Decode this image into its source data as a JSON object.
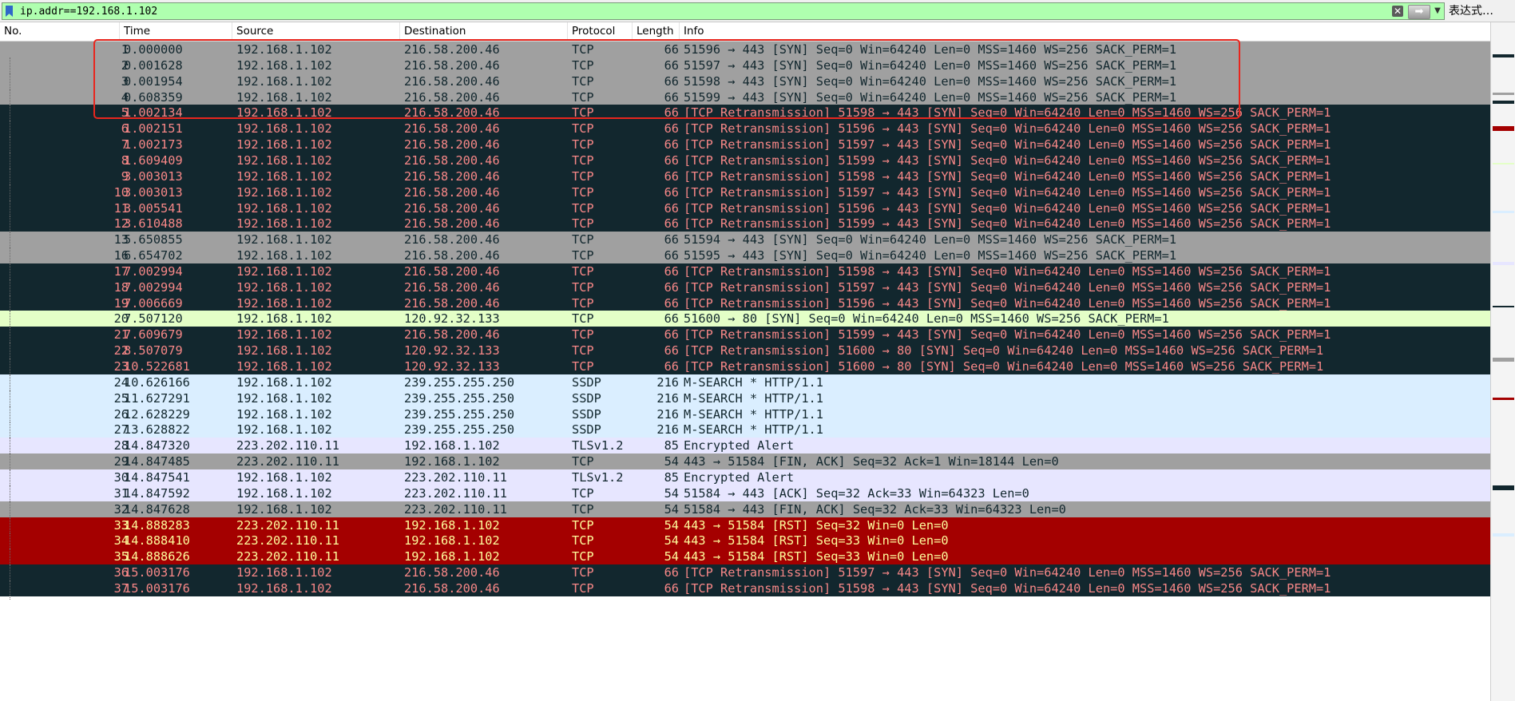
{
  "filter": {
    "value": "ip.addr==192.168.1.102",
    "clear_icon": "clear-x-icon",
    "apply_icon": "apply-arrow-icon",
    "history_icon": "chevron-down-icon",
    "expression_label": "表达式…"
  },
  "columns": [
    {
      "key": "no",
      "label": "No."
    },
    {
      "key": "time",
      "label": "Time"
    },
    {
      "key": "source",
      "label": "Source"
    },
    {
      "key": "destination",
      "label": "Destination"
    },
    {
      "key": "protocol",
      "label": "Protocol"
    },
    {
      "key": "length",
      "label": "Length"
    },
    {
      "key": "info",
      "label": "Info"
    }
  ],
  "row_colors": {
    "gray": {
      "bg": "#a0a0a0",
      "fg": "#12272e"
    },
    "retrans": {
      "bg": "#12272e",
      "fg": "#f78787"
    },
    "green": {
      "bg": "#e4ffc7",
      "fg": "#12272e"
    },
    "blue": {
      "bg": "#daeeff",
      "fg": "#12272e"
    },
    "purple": {
      "bg": "#e7e6ff",
      "fg": "#12272e"
    },
    "red": {
      "bg": "#a40000",
      "fg": "#fffc9c"
    }
  },
  "packets": [
    {
      "no": "1",
      "time": "0.000000",
      "src": "192.168.1.102",
      "dst": "216.58.200.46",
      "proto": "TCP",
      "len": "66",
      "info": "51596 → 443 [SYN] Seq=0 Win=64240 Len=0 MSS=1460 WS=256 SACK_PERM=1",
      "style": "gray"
    },
    {
      "no": "2",
      "time": "0.001628",
      "src": "192.168.1.102",
      "dst": "216.58.200.46",
      "proto": "TCP",
      "len": "66",
      "info": "51597 → 443 [SYN] Seq=0 Win=64240 Len=0 MSS=1460 WS=256 SACK_PERM=1",
      "style": "gray"
    },
    {
      "no": "3",
      "time": "0.001954",
      "src": "192.168.1.102",
      "dst": "216.58.200.46",
      "proto": "TCP",
      "len": "66",
      "info": "51598 → 443 [SYN] Seq=0 Win=64240 Len=0 MSS=1460 WS=256 SACK_PERM=1",
      "style": "gray"
    },
    {
      "no": "4",
      "time": "0.608359",
      "src": "192.168.1.102",
      "dst": "216.58.200.46",
      "proto": "TCP",
      "len": "66",
      "info": "51599 → 443 [SYN] Seq=0 Win=64240 Len=0 MSS=1460 WS=256 SACK_PERM=1",
      "style": "gray"
    },
    {
      "no": "5",
      "time": "1.002134",
      "src": "192.168.1.102",
      "dst": "216.58.200.46",
      "proto": "TCP",
      "len": "66",
      "info": "[TCP Retransmission] 51598 → 443 [SYN] Seq=0 Win=64240 Len=0 MSS=1460 WS=256 SACK_PERM=1",
      "style": "retrans"
    },
    {
      "no": "6",
      "time": "1.002151",
      "src": "192.168.1.102",
      "dst": "216.58.200.46",
      "proto": "TCP",
      "len": "66",
      "info": "[TCP Retransmission] 51596 → 443 [SYN] Seq=0 Win=64240 Len=0 MSS=1460 WS=256 SACK_PERM=1",
      "style": "retrans"
    },
    {
      "no": "7",
      "time": "1.002173",
      "src": "192.168.1.102",
      "dst": "216.58.200.46",
      "proto": "TCP",
      "len": "66",
      "info": "[TCP Retransmission] 51597 → 443 [SYN] Seq=0 Win=64240 Len=0 MSS=1460 WS=256 SACK_PERM=1",
      "style": "retrans"
    },
    {
      "no": "8",
      "time": "1.609409",
      "src": "192.168.1.102",
      "dst": "216.58.200.46",
      "proto": "TCP",
      "len": "66",
      "info": "[TCP Retransmission] 51599 → 443 [SYN] Seq=0 Win=64240 Len=0 MSS=1460 WS=256 SACK_PERM=1",
      "style": "retrans"
    },
    {
      "no": "9",
      "time": "3.003013",
      "src": "192.168.1.102",
      "dst": "216.58.200.46",
      "proto": "TCP",
      "len": "66",
      "info": "[TCP Retransmission] 51598 → 443 [SYN] Seq=0 Win=64240 Len=0 MSS=1460 WS=256 SACK_PERM=1",
      "style": "retrans"
    },
    {
      "no": "10",
      "time": "3.003013",
      "src": "192.168.1.102",
      "dst": "216.58.200.46",
      "proto": "TCP",
      "len": "66",
      "info": "[TCP Retransmission] 51597 → 443 [SYN] Seq=0 Win=64240 Len=0 MSS=1460 WS=256 SACK_PERM=1",
      "style": "retrans"
    },
    {
      "no": "11",
      "time": "3.005541",
      "src": "192.168.1.102",
      "dst": "216.58.200.46",
      "proto": "TCP",
      "len": "66",
      "info": "[TCP Retransmission] 51596 → 443 [SYN] Seq=0 Win=64240 Len=0 MSS=1460 WS=256 SACK_PERM=1",
      "style": "retrans"
    },
    {
      "no": "12",
      "time": "3.610488",
      "src": "192.168.1.102",
      "dst": "216.58.200.46",
      "proto": "TCP",
      "len": "66",
      "info": "[TCP Retransmission] 51599 → 443 [SYN] Seq=0 Win=64240 Len=0 MSS=1460 WS=256 SACK_PERM=1",
      "style": "retrans"
    },
    {
      "no": "13",
      "time": "5.650855",
      "src": "192.168.1.102",
      "dst": "216.58.200.46",
      "proto": "TCP",
      "len": "66",
      "info": "51594 → 443 [SYN] Seq=0 Win=64240 Len=0 MSS=1460 WS=256 SACK_PERM=1",
      "style": "gray"
    },
    {
      "no": "16",
      "time": "6.654702",
      "src": "192.168.1.102",
      "dst": "216.58.200.46",
      "proto": "TCP",
      "len": "66",
      "info": "51595 → 443 [SYN] Seq=0 Win=64240 Len=0 MSS=1460 WS=256 SACK_PERM=1",
      "style": "gray"
    },
    {
      "no": "17",
      "time": "7.002994",
      "src": "192.168.1.102",
      "dst": "216.58.200.46",
      "proto": "TCP",
      "len": "66",
      "info": "[TCP Retransmission] 51598 → 443 [SYN] Seq=0 Win=64240 Len=0 MSS=1460 WS=256 SACK_PERM=1",
      "style": "retrans"
    },
    {
      "no": "18",
      "time": "7.002994",
      "src": "192.168.1.102",
      "dst": "216.58.200.46",
      "proto": "TCP",
      "len": "66",
      "info": "[TCP Retransmission] 51597 → 443 [SYN] Seq=0 Win=64240 Len=0 MSS=1460 WS=256 SACK_PERM=1",
      "style": "retrans"
    },
    {
      "no": "19",
      "time": "7.006669",
      "src": "192.168.1.102",
      "dst": "216.58.200.46",
      "proto": "TCP",
      "len": "66",
      "info": "[TCP Retransmission] 51596 → 443 [SYN] Seq=0 Win=64240 Len=0 MSS=1460 WS=256 SACK_PERM=1",
      "style": "retrans"
    },
    {
      "no": "20",
      "time": "7.507120",
      "src": "192.168.1.102",
      "dst": "120.92.32.133",
      "proto": "TCP",
      "len": "66",
      "info": "51600 → 80 [SYN] Seq=0 Win=64240 Len=0 MSS=1460 WS=256 SACK_PERM=1",
      "style": "green"
    },
    {
      "no": "21",
      "time": "7.609679",
      "src": "192.168.1.102",
      "dst": "216.58.200.46",
      "proto": "TCP",
      "len": "66",
      "info": "[TCP Retransmission] 51599 → 443 [SYN] Seq=0 Win=64240 Len=0 MSS=1460 WS=256 SACK_PERM=1",
      "style": "retrans"
    },
    {
      "no": "22",
      "time": "8.507079",
      "src": "192.168.1.102",
      "dst": "120.92.32.133",
      "proto": "TCP",
      "len": "66",
      "info": "[TCP Retransmission] 51600 → 80 [SYN] Seq=0 Win=64240 Len=0 MSS=1460 WS=256 SACK_PERM=1",
      "style": "retrans"
    },
    {
      "no": "23",
      "time": "10.522681",
      "src": "192.168.1.102",
      "dst": "120.92.32.133",
      "proto": "TCP",
      "len": "66",
      "info": "[TCP Retransmission] 51600 → 80 [SYN] Seq=0 Win=64240 Len=0 MSS=1460 WS=256 SACK_PERM=1",
      "style": "retrans"
    },
    {
      "no": "24",
      "time": "10.626166",
      "src": "192.168.1.102",
      "dst": "239.255.255.250",
      "proto": "SSDP",
      "len": "216",
      "info": "M-SEARCH * HTTP/1.1",
      "style": "blue"
    },
    {
      "no": "25",
      "time": "11.627291",
      "src": "192.168.1.102",
      "dst": "239.255.255.250",
      "proto": "SSDP",
      "len": "216",
      "info": "M-SEARCH * HTTP/1.1",
      "style": "blue"
    },
    {
      "no": "26",
      "time": "12.628229",
      "src": "192.168.1.102",
      "dst": "239.255.255.250",
      "proto": "SSDP",
      "len": "216",
      "info": "M-SEARCH * HTTP/1.1",
      "style": "blue"
    },
    {
      "no": "27",
      "time": "13.628822",
      "src": "192.168.1.102",
      "dst": "239.255.255.250",
      "proto": "SSDP",
      "len": "216",
      "info": "M-SEARCH * HTTP/1.1",
      "style": "blue"
    },
    {
      "no": "28",
      "time": "14.847320",
      "src": "223.202.110.11",
      "dst": "192.168.1.102",
      "proto": "TLSv1.2",
      "len": "85",
      "info": "Encrypted Alert",
      "style": "purple"
    },
    {
      "no": "29",
      "time": "14.847485",
      "src": "223.202.110.11",
      "dst": "192.168.1.102",
      "proto": "TCP",
      "len": "54",
      "info": "443 → 51584 [FIN, ACK] Seq=32 Ack=1 Win=18144 Len=0",
      "style": "gray"
    },
    {
      "no": "30",
      "time": "14.847541",
      "src": "192.168.1.102",
      "dst": "223.202.110.11",
      "proto": "TLSv1.2",
      "len": "85",
      "info": "Encrypted Alert",
      "style": "purple"
    },
    {
      "no": "31",
      "time": "14.847592",
      "src": "192.168.1.102",
      "dst": "223.202.110.11",
      "proto": "TCP",
      "len": "54",
      "info": "51584 → 443 [ACK] Seq=32 Ack=33 Win=64323 Len=0",
      "style": "purple"
    },
    {
      "no": "32",
      "time": "14.847628",
      "src": "192.168.1.102",
      "dst": "223.202.110.11",
      "proto": "TCP",
      "len": "54",
      "info": "51584 → 443 [FIN, ACK] Seq=32 Ack=33 Win=64323 Len=0",
      "style": "gray"
    },
    {
      "no": "33",
      "time": "14.888283",
      "src": "223.202.110.11",
      "dst": "192.168.1.102",
      "proto": "TCP",
      "len": "54",
      "info": "443 → 51584 [RST] Seq=32 Win=0 Len=0",
      "style": "red"
    },
    {
      "no": "34",
      "time": "14.888410",
      "src": "223.202.110.11",
      "dst": "192.168.1.102",
      "proto": "TCP",
      "len": "54",
      "info": "443 → 51584 [RST] Seq=33 Win=0 Len=0",
      "style": "red"
    },
    {
      "no": "35",
      "time": "14.888626",
      "src": "223.202.110.11",
      "dst": "192.168.1.102",
      "proto": "TCP",
      "len": "54",
      "info": "443 → 51584 [RST] Seq=33 Win=0 Len=0",
      "style": "red"
    },
    {
      "no": "36",
      "time": "15.003176",
      "src": "192.168.1.102",
      "dst": "216.58.200.46",
      "proto": "TCP",
      "len": "66",
      "info": "[TCP Retransmission] 51597 → 443 [SYN] Seq=0 Win=64240 Len=0 MSS=1460 WS=256 SACK_PERM=1",
      "style": "retrans"
    },
    {
      "no": "37",
      "time": "15.003176",
      "src": "192.168.1.102",
      "dst": "216.58.200.46",
      "proto": "TCP",
      "len": "66",
      "info": "[TCP Retransmission] 51598 → 443 [SYN] Seq=0 Win=64240 Len=0 MSS=1460 WS=256 SACK_PERM=1",
      "style": "retrans"
    }
  ],
  "selection_box": {
    "color": "#e8261e",
    "first_row": "1",
    "last_row": "4"
  },
  "packet_map_colors": [
    "#12272e",
    "#a0a0a0",
    "#12272e",
    "#a40000",
    "#e4ffc7",
    "#daeeff",
    "#e7e6ff",
    "#12272e",
    "#a0a0a0",
    "#a40000",
    "#12272e",
    "#daeeff"
  ]
}
